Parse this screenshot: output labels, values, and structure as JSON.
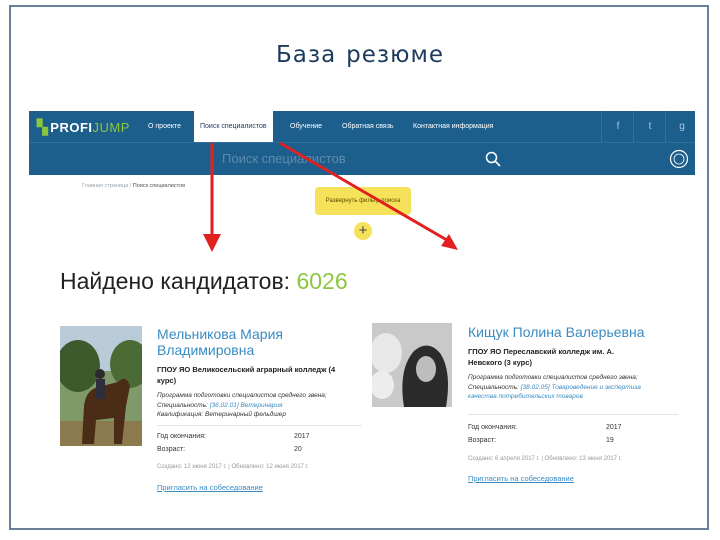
{
  "slide": {
    "title_word1": "База",
    "title_word2": "резюме"
  },
  "nav": {
    "logo_main": "PROFI",
    "logo_accent": "JUMP",
    "items": [
      {
        "label": "О проекте"
      },
      {
        "label": "Поиск специалистов"
      },
      {
        "label": "Обучение"
      },
      {
        "label": "Обратная связь"
      },
      {
        "label": "Контактная информация"
      }
    ],
    "social": [
      "f",
      "t",
      "g"
    ]
  },
  "search": {
    "placeholder": "Поиск специалистов"
  },
  "breadcrumb": {
    "home": "Главная страница",
    "current": "Поиск специалистов"
  },
  "tooltip": {
    "text": "Развернуть фильтр поиска"
  },
  "results": {
    "label": "Найдено кандидатов: ",
    "count": "6026"
  },
  "cards": [
    {
      "name_line1": "Мельникова Мария",
      "name_line2": "Владимировна",
      "edu_line1": "ГПОУ ЯО Великосельский аграрный колледж (4",
      "edu_line2": "курс)",
      "program": "Программа подготовки специалистов среднего звена;",
      "spec_label": "Специальность:",
      "spec_value": "[36.02.01] Ветеринария",
      "qual": "Квалификация: Ветеринарный фельдшер",
      "year_label": "Год окончания:",
      "year_value": "2017",
      "age_label": "Возраст:",
      "age_value": "20",
      "meta": "Создано: 12 июня 2017 г. | Обновлено: 12 июня 2017 г.",
      "invite": "Пригласить на собеседование"
    },
    {
      "name_line1": "Кищук Полина Валерьевна",
      "edu_line1": "ГПОУ ЯО Переславский колледж им. А.",
      "edu_line2": "Невского (3 курс)",
      "program": "Программа подготовки специалистов среднего звена;",
      "spec_label": "Специальность:",
      "spec_value": "[38.02.05] Товароведение и экспертиза",
      "spec_value2": "качества потребительских товаров",
      "year_label": "Год окончания:",
      "year_value": "2017",
      "age_label": "Возраст:",
      "age_value": "19",
      "meta": "Создано: 6 апреля 2017 г. | Обновлено: 13 июня 2017 г.",
      "invite": "Пригласить на собеседование"
    }
  ],
  "colors": {
    "nav": "#1d5f8c",
    "accent": "#8cc63f",
    "arrow": "#e0211f",
    "tooltip": "#f6e25a",
    "link": "#3a8bc2"
  }
}
